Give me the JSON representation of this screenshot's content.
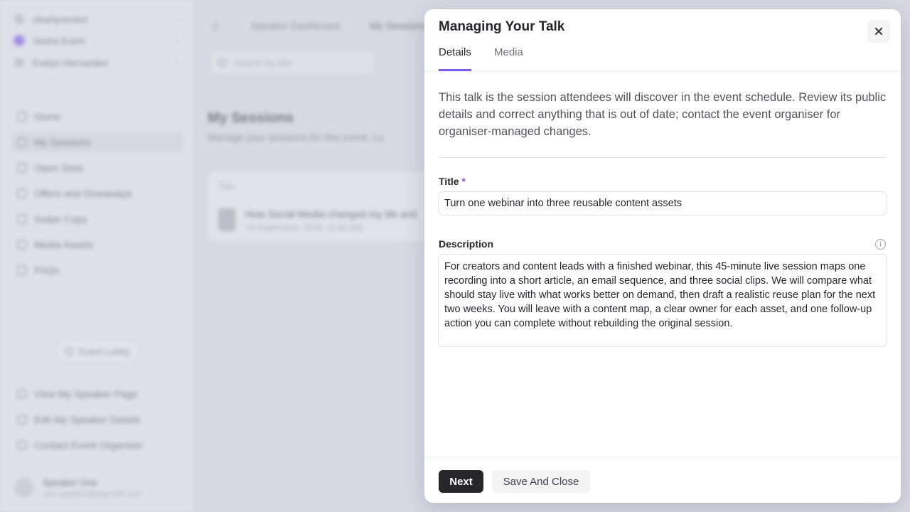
{
  "background": {
    "workspaces": [
      {
        "label": "clearlyvented",
        "active": false
      },
      {
        "label": "Vastra Event",
        "active": true
      },
      {
        "label": "Evelyn Hernandez",
        "active": false
      }
    ],
    "nav": [
      {
        "label": "Home",
        "icon": "home-icon",
        "active": false
      },
      {
        "label": "My Sessions",
        "icon": "sessions-icon",
        "active": true
      },
      {
        "label": "Open Slots",
        "icon": "slots-icon",
        "active": false
      },
      {
        "label": "Offers and Giveaways",
        "icon": "offers-icon",
        "active": false
      },
      {
        "label": "Swipe Copy",
        "icon": "copy-icon",
        "active": false
      },
      {
        "label": "Media Assets",
        "icon": "media-icon",
        "active": false
      },
      {
        "label": "FAQs",
        "icon": "faq-icon",
        "active": false
      }
    ],
    "lobby_label": "Event Lobby",
    "footer_links": [
      {
        "label": "View My Speaker Page",
        "icon": "eye-icon"
      },
      {
        "label": "Edit My Speaker Details",
        "icon": "pencil-icon"
      },
      {
        "label": "Contact Event Organiser",
        "icon": "mail-icon"
      }
    ],
    "user": {
      "name": "Speaker One",
      "email": "sam.speaker@logicsoft.com"
    },
    "breadcrumb": [
      "Speaker Dashboard",
      "My Sessions"
    ],
    "search_placeholder": "Search by title",
    "page_title": "My Sessions",
    "page_subtitle": "Manage your sessions for this event. Lo",
    "table_header": "Title",
    "session_title": "How Social Media changed my life and",
    "session_date": "14 September, 2026, 11:00 AM"
  },
  "modal": {
    "title": "Managing Your Talk",
    "tabs": [
      {
        "label": "Details",
        "active": true
      },
      {
        "label": "Media",
        "active": false
      }
    ],
    "intro": "This talk is the session attendees will discover in the event schedule. Review its public details and correct anything that is out of date; contact the event organiser for organiser-managed changes.",
    "title_label": "Title",
    "required_mark": "*",
    "title_value": "Turn one webinar into three reusable content assets",
    "description_label": "Description",
    "description_value": "For creators and content leads with a finished webinar, this 45-minute live session maps one recording into a short article, an email sequence, and three social clips. We will compare what should stay live with what works better on demand, then draft a realistic reuse plan for the next two weeks. You will leave with a content map, a clear owner for each asset, and one follow-up action you can complete without rebuilding the original session.",
    "next_label": "Next",
    "save_close_label": "Save And Close"
  },
  "colors": {
    "accent": "#7c5cf0",
    "primary_button": "#27272a",
    "secondary_button": "#f4f4f5"
  }
}
